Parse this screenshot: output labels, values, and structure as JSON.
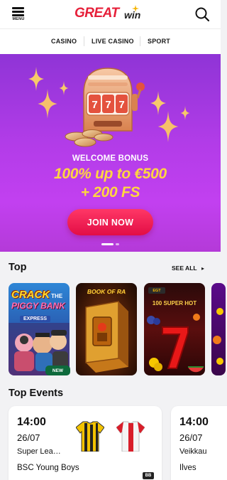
{
  "header": {
    "menu_label": "MENU",
    "logo_great": "GREAT",
    "logo_win": "win",
    "brand_color": "#e6203a",
    "search_icon": "search-icon"
  },
  "nav": {
    "tabs": [
      {
        "label": "CASINO"
      },
      {
        "label": "LIVE CASINO"
      },
      {
        "label": "SPORT"
      }
    ]
  },
  "hero": {
    "title": "WELCOME BONUS",
    "offer_line1": "100% up to €500",
    "offer_line2": "+ 200 FS",
    "cta_label": "JOIN NOW",
    "slides_count": 2,
    "active_slide": 1,
    "gradient_colors": [
      "#8f34d6",
      "#c240f0"
    ],
    "accent_yellow": "#ffd640",
    "cta_color": "#ef1a4e"
  },
  "top_section": {
    "title": "Top",
    "see_all_label": "SEE ALL",
    "games": [
      {
        "title_line1": "CRACK",
        "title_line2": "PIGGY BANK",
        "title_the": "THE",
        "title_sub": "EXPRESS",
        "badge": "NEW"
      },
      {
        "title": "BOOK OF RA"
      },
      {
        "title": "100 SUPER HOT",
        "top_label": "EGT"
      },
      {
        "title": ""
      }
    ]
  },
  "events_section": {
    "title": "Top Events",
    "events": [
      {
        "time": "14:00",
        "date": "26/07",
        "league": "Super Lea…",
        "team": "BSC Young Boys",
        "badge": "BB"
      },
      {
        "time": "14:00",
        "date": "26/07",
        "league": "Veikkau",
        "team": "Ilves"
      }
    ]
  }
}
